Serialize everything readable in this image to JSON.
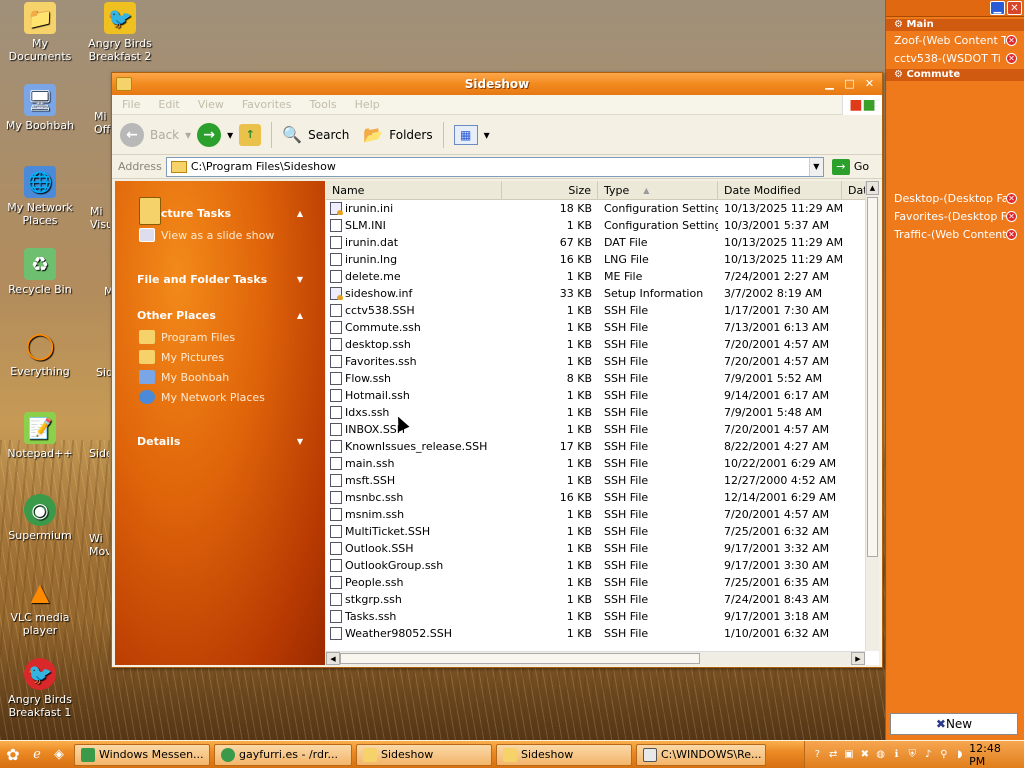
{
  "desktop": {
    "icons": [
      {
        "label": "My Documents"
      },
      {
        "label": "Angry Birds Breakfast 2"
      },
      {
        "label": "My Boohbah"
      },
      {
        "label": "My Network Places"
      },
      {
        "label": "Recycle Bin"
      },
      {
        "label": "Everything"
      },
      {
        "label": "Notepad++"
      },
      {
        "label": "Supermium"
      },
      {
        "label": "VLC media player"
      },
      {
        "label": "Angry Birds Breakfast 1"
      }
    ],
    "partial_labels": [
      "Mi Off",
      "Mi Visu",
      "M",
      "Sid",
      "Side",
      "Wi Movi"
    ]
  },
  "sidebar": {
    "sections": [
      {
        "title": "Main",
        "items": [
          "Zoof-(Web Content Ti",
          "cctv538-(WSDOT Ti"
        ]
      },
      {
        "title": "Commute",
        "items": []
      }
    ],
    "bottom_items": [
      "Desktop-(Desktop Fa",
      "Favorites-(Desktop F",
      "Traffic-(Web Content"
    ],
    "new_button": "New"
  },
  "window": {
    "title": "Sideshow",
    "menu": [
      "File",
      "Edit",
      "View",
      "Favorites",
      "Tools",
      "Help"
    ],
    "toolbar": {
      "back": "Back",
      "search": "Search",
      "folders": "Folders"
    },
    "address": {
      "label": "Address",
      "value": "C:\\Program Files\\Sideshow",
      "go": "Go"
    },
    "taskpane": {
      "groups": [
        {
          "title": "Picture Tasks",
          "items": [
            "View as a slide show"
          ]
        },
        {
          "title": "File and Folder Tasks",
          "items": []
        },
        {
          "title": "Other Places",
          "items": [
            "Program Files",
            "My Pictures",
            "My Boohbah",
            "My Network Places"
          ]
        },
        {
          "title": "Details",
          "items": []
        }
      ]
    },
    "columns": {
      "name": "Name",
      "size": "Size",
      "type": "Type",
      "date": "Date Modified",
      "dat": "Dat"
    },
    "files": [
      {
        "name": "irunin.ini",
        "size": "18 KB",
        "type": "Configuration Settings",
        "date": "10/13/2025 11:29 AM",
        "icon": "setting"
      },
      {
        "name": "SLM.INI",
        "size": "1 KB",
        "type": "Configuration Settings",
        "date": "10/3/2001 5:37 AM",
        "icon": "plain"
      },
      {
        "name": "irunin.dat",
        "size": "67 KB",
        "type": "DAT File",
        "date": "10/13/2025 11:29 AM",
        "icon": "file"
      },
      {
        "name": "irunin.lng",
        "size": "16 KB",
        "type": "LNG File",
        "date": "10/13/2025 11:29 AM",
        "icon": "file"
      },
      {
        "name": "delete.me",
        "size": "1 KB",
        "type": "ME File",
        "date": "7/24/2001 2:27 AM",
        "icon": "file"
      },
      {
        "name": "sideshow.inf",
        "size": "33 KB",
        "type": "Setup Information",
        "date": "3/7/2002 8:19 AM",
        "icon": "setting"
      },
      {
        "name": "cctv538.SSH",
        "size": "1 KB",
        "type": "SSH File",
        "date": "1/17/2001 7:30 AM",
        "icon": "file"
      },
      {
        "name": "Commute.ssh",
        "size": "1 KB",
        "type": "SSH File",
        "date": "7/13/2001 6:13 AM",
        "icon": "file"
      },
      {
        "name": "desktop.ssh",
        "size": "1 KB",
        "type": "SSH File",
        "date": "7/20/2001 4:57 AM",
        "icon": "file"
      },
      {
        "name": "Favorites.ssh",
        "size": "1 KB",
        "type": "SSH File",
        "date": "7/20/2001 4:57 AM",
        "icon": "file"
      },
      {
        "name": "Flow.ssh",
        "size": "8 KB",
        "type": "SSH File",
        "date": "7/9/2001 5:52 AM",
        "icon": "file"
      },
      {
        "name": "Hotmail.ssh",
        "size": "1 KB",
        "type": "SSH File",
        "date": "9/14/2001 6:17 AM",
        "icon": "file"
      },
      {
        "name": "Idxs.ssh",
        "size": "1 KB",
        "type": "SSH File",
        "date": "7/9/2001 5:48 AM",
        "icon": "file"
      },
      {
        "name": "INBOX.SSH",
        "size": "1 KB",
        "type": "SSH File",
        "date": "7/20/2001 4:57 AM",
        "icon": "file"
      },
      {
        "name": "KnownIssues_release.SSH",
        "size": "17 KB",
        "type": "SSH File",
        "date": "8/22/2001 4:27 AM",
        "icon": "file"
      },
      {
        "name": "main.ssh",
        "size": "1 KB",
        "type": "SSH File",
        "date": "10/22/2001 6:29 AM",
        "icon": "file"
      },
      {
        "name": "msft.SSH",
        "size": "1 KB",
        "type": "SSH File",
        "date": "12/27/2000 4:52 AM",
        "icon": "file"
      },
      {
        "name": "msnbc.ssh",
        "size": "16 KB",
        "type": "SSH File",
        "date": "12/14/2001 6:29 AM",
        "icon": "file"
      },
      {
        "name": "msnim.ssh",
        "size": "1 KB",
        "type": "SSH File",
        "date": "7/20/2001 4:57 AM",
        "icon": "file"
      },
      {
        "name": "MultiTicket.SSH",
        "size": "1 KB",
        "type": "SSH File",
        "date": "7/25/2001 6:32 AM",
        "icon": "file"
      },
      {
        "name": "Outlook.SSH",
        "size": "1 KB",
        "type": "SSH File",
        "date": "9/17/2001 3:32 AM",
        "icon": "file"
      },
      {
        "name": "OutlookGroup.ssh",
        "size": "1 KB",
        "type": "SSH File",
        "date": "9/17/2001 3:30 AM",
        "icon": "file"
      },
      {
        "name": "People.ssh",
        "size": "1 KB",
        "type": "SSH File",
        "date": "7/25/2001 6:35 AM",
        "icon": "file"
      },
      {
        "name": "stkgrp.ssh",
        "size": "1 KB",
        "type": "SSH File",
        "date": "7/24/2001 8:43 AM",
        "icon": "file"
      },
      {
        "name": "Tasks.ssh",
        "size": "1 KB",
        "type": "SSH File",
        "date": "9/17/2001 3:18 AM",
        "icon": "file"
      },
      {
        "name": "Weather98052.SSH",
        "size": "1 KB",
        "type": "SSH File",
        "date": "1/10/2001 6:32 AM",
        "icon": "file"
      }
    ]
  },
  "taskbar": {
    "tasks": [
      "Windows Messen...",
      "gayfurri.es - /rdr...",
      "Sideshow",
      "Sideshow",
      "C:\\WINDOWS\\Re..."
    ],
    "clock": "12:48 PM"
  }
}
